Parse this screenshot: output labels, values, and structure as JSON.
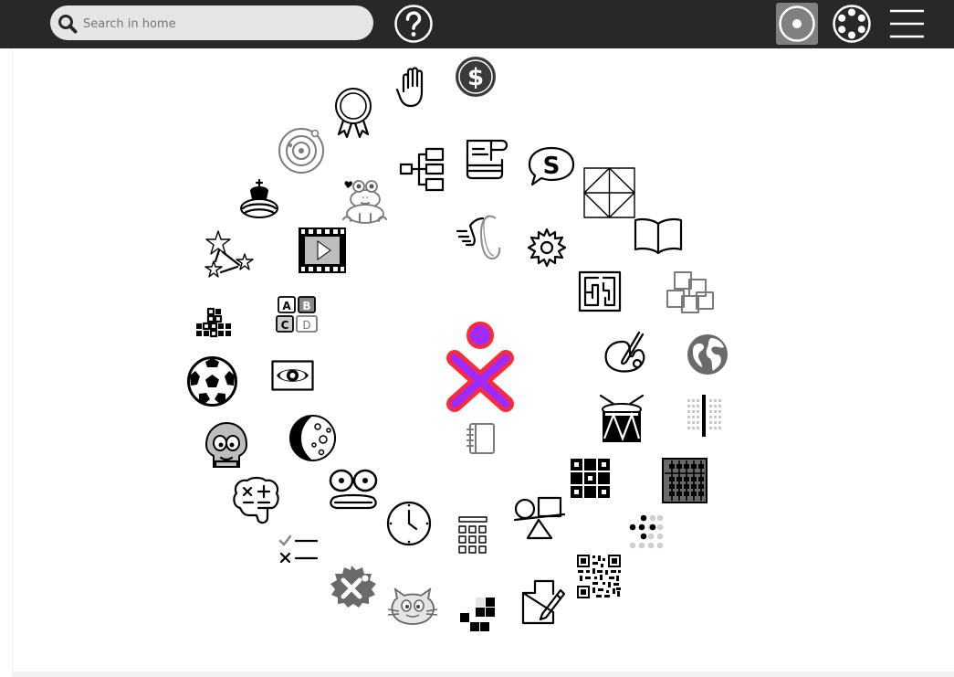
{
  "toolbar": {
    "search_placeholder": "Search in home",
    "background": "#282828"
  },
  "colors": {
    "xo_stroke": "#ff2b34",
    "xo_fill": "#a02bff",
    "active_button": "#808080"
  },
  "icons": {
    "search": "search-icon",
    "help": "help-icon",
    "favorites_view": "favorites-view-icon",
    "ring_view": "ring-view-icon",
    "list_view": "list-view-icon",
    "xo": "xo-owner-icon"
  },
  "activities": [
    "browse",
    "help",
    "moon",
    "chat",
    "terminal",
    "calculate",
    "measure",
    "turtle",
    "paint",
    "record",
    "clock",
    "jukebox",
    "write",
    "memorize",
    "pippy",
    "log",
    "implode",
    "maze",
    "physics",
    "abacus",
    "speak",
    "labyrinth",
    "portfolio",
    "read",
    "fototoon",
    "scratch",
    "finance",
    "get-books",
    "chess",
    "color-deducto",
    "soccer",
    "stopwatch",
    "qr-reader",
    "music-keyboard",
    "tamtam",
    "4-in-a-row",
    "typing-turtle",
    "solar-system",
    "frog",
    "award",
    "to-do",
    "brain",
    "dimensions",
    "fill-in"
  ]
}
